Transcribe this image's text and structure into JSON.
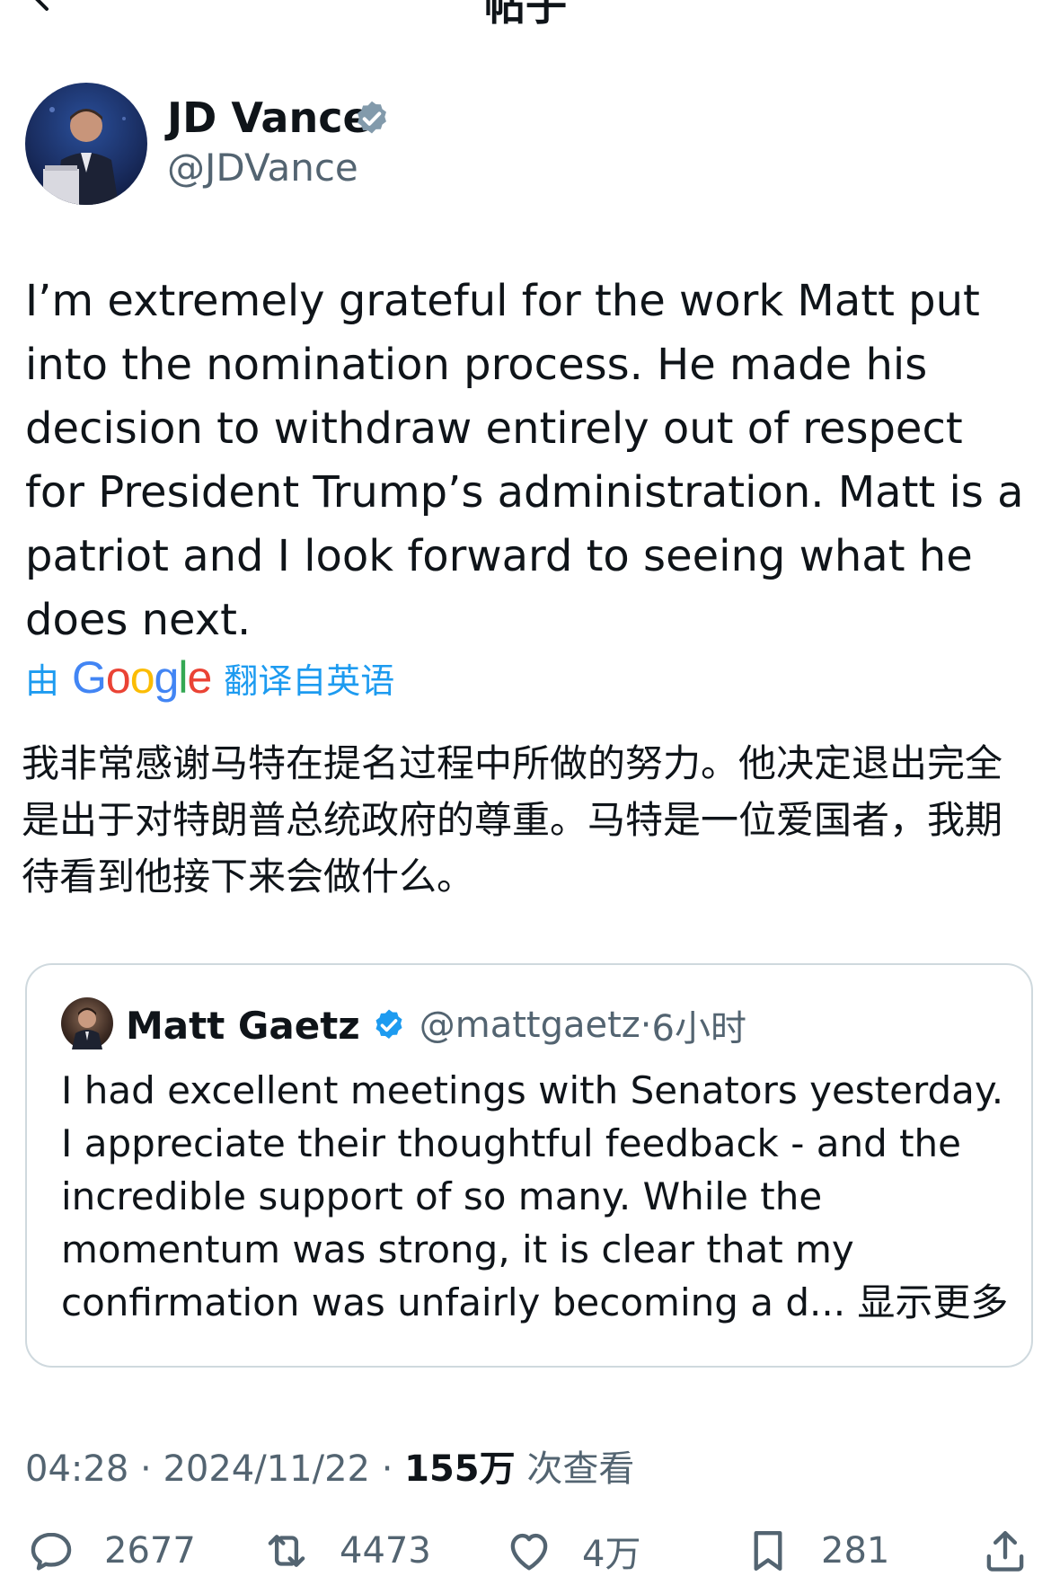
{
  "nav": {
    "title": "帖子"
  },
  "author": {
    "name": "JD Vance",
    "handle": "@JDVance",
    "verified": true
  },
  "tweet": {
    "text": "I’m extremely grateful for the work Matt put into the nomination process. He made his decision to withdraw entirely out of respect for President Trump’s administration. Matt is a patriot and I look forward to seeing what he does next."
  },
  "translation": {
    "prefix": "由",
    "brand": "Google",
    "suffix": "翻译自英语",
    "text": "我非常感谢马特在提名过程中所做的努力。他决定退出完全是出于对特朗普总统政府的尊重。马特是一位爱国者，我期待看到他接下来会做什么。"
  },
  "quoted": {
    "name": "Matt Gaetz",
    "handle": "@mattgaetz",
    "separator": "·",
    "time": "6小时",
    "text": "I had excellent meetings with Senators yesterday.  I appreciate their thoughtful feedback - and the incredible support of so many.  While the momentum was strong, it is clear that my confirmation was unfairly becoming a d...",
    "show_more": "显示更多"
  },
  "meta": {
    "time": "04:28",
    "separator": "·",
    "date": "2024/11/22",
    "views_count": "155万",
    "views_label": "次查看"
  },
  "actions": {
    "replies": "2677",
    "reposts": "4473",
    "likes": "4万",
    "bookmarks": "281"
  },
  "colors": {
    "accent": "#1d9bf0",
    "text": "#0f1419",
    "secondary": "#536471",
    "border": "#cfd9de"
  },
  "icons": [
    "back-arrow-icon",
    "verified-badge-icon",
    "reply-icon",
    "repost-icon",
    "like-icon",
    "bookmark-icon",
    "share-icon"
  ]
}
